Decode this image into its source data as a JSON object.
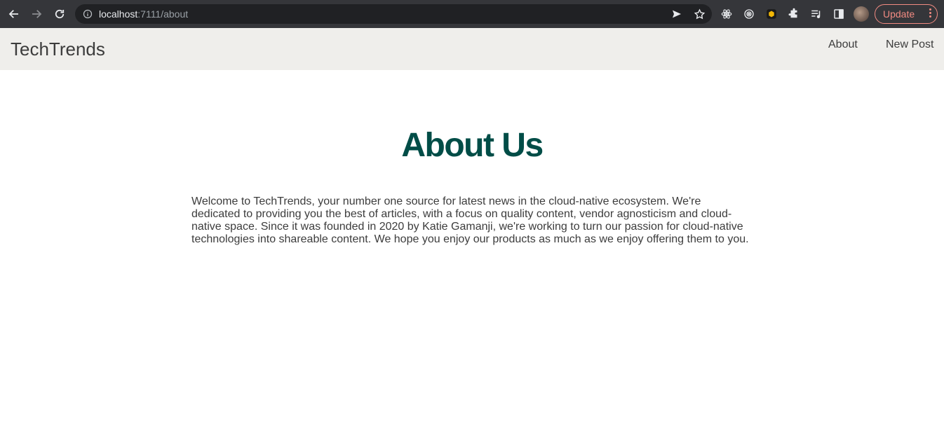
{
  "browser": {
    "url_host": "localhost",
    "url_rest": ":7111/about",
    "update_label": "Update"
  },
  "site": {
    "brand": "TechTrends",
    "nav": [
      {
        "label": "About"
      },
      {
        "label": "New Post"
      }
    ]
  },
  "page": {
    "heading": "About Us",
    "body": "Welcome to TechTrends, your number one source for latest news in the cloud-native ecosystem. We're dedicated to providing you the best of articles, with a focus on quality content, vendor agnosticism and cloud-native space. Since it was founded in 2020 by Katie Gamanji, we're working to turn our passion for cloud-native technologies into shareable content. We hope you enjoy our products as much as we enjoy offering them to you."
  },
  "colors": {
    "heading": "#004d47",
    "navbar_bg": "#efeeeb",
    "update_accent": "#f28b82"
  }
}
